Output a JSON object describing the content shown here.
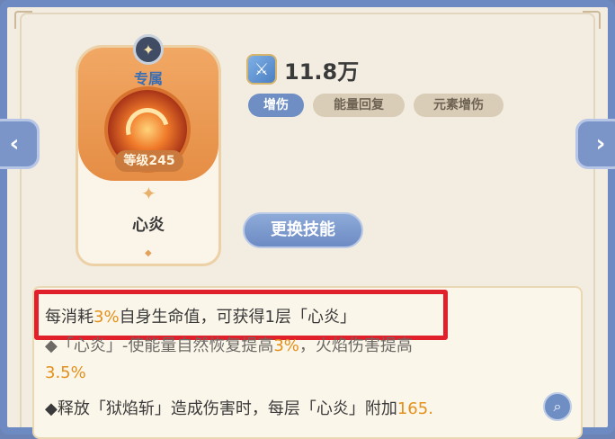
{
  "power": "11.8万",
  "tags": [
    "增伤",
    "能量回复",
    "元素增伤"
  ],
  "skill_card": {
    "exclusive_label": "专属",
    "level_label": "等级245",
    "skill_name": "心炎"
  },
  "change_skill_label": "更换技能",
  "description": {
    "line1_pre": "每消耗",
    "line1_num": "3%",
    "line1_post": "自身生命值，可获得1层「心炎」",
    "line2_pre": "◆「心炎」-使能量自然恢复提高",
    "line2_num": "3%",
    "line2_post": "，火焰伤害提高",
    "line3_num": "3.5%",
    "line4_pre": "◆释放「狱焰斩」造成伤害时，每层「心炎」附加",
    "line4_num": "165."
  },
  "colors": {
    "accent_blue": "#6f8fc4",
    "highlight_number": "#e3901c",
    "highlight_box": "#e0202a"
  },
  "icons": {
    "prev": "chevron-left-icon",
    "next": "chevron-right-icon",
    "power": "sword-shield-icon",
    "zoom": "magnifier-icon"
  }
}
